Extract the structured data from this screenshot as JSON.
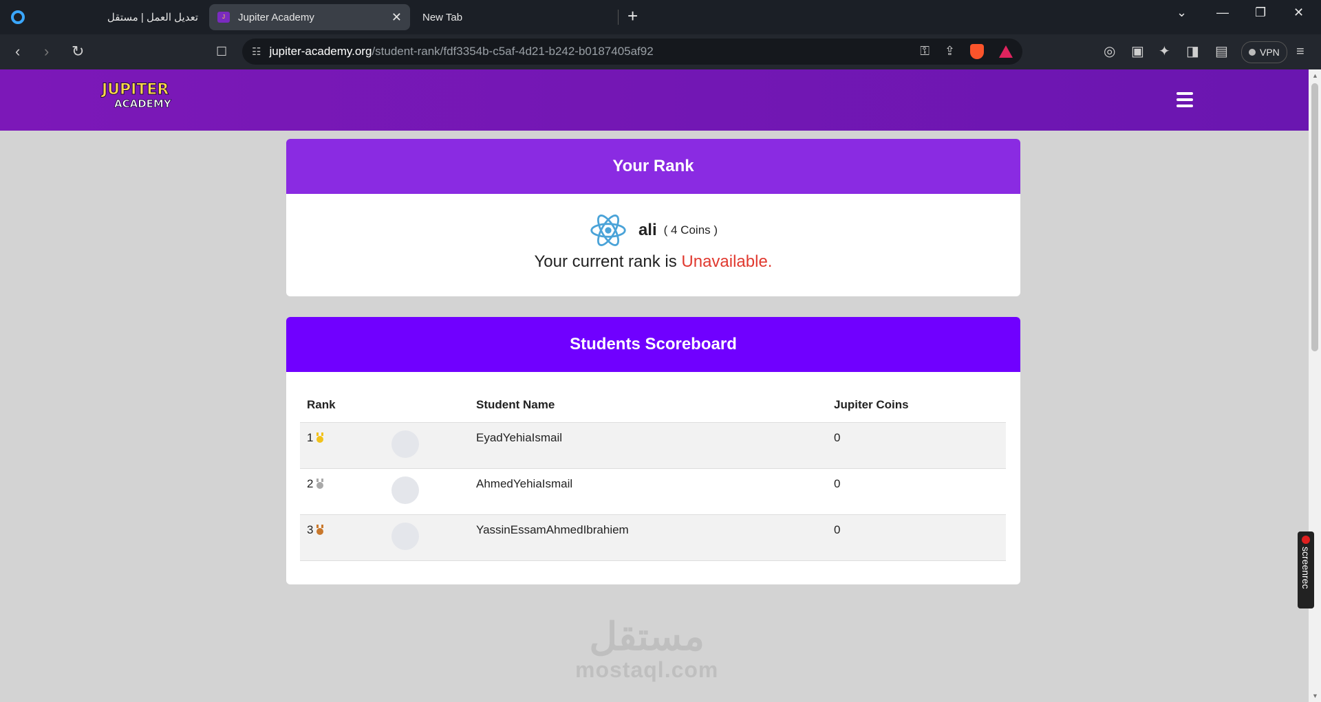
{
  "browser": {
    "tabs": [
      {
        "title": "تعديل العمل | مستقل"
      },
      {
        "title": "Jupiter Academy",
        "close": "✕"
      },
      {
        "title": "New Tab"
      }
    ],
    "new_tab": "+",
    "window_controls": {
      "dropdown": "⌄",
      "minimize": "—",
      "restore": "❐",
      "close": "✕"
    },
    "url_host": "jupiter-academy.org",
    "url_path": "/student-rank/fdf3354b-c5af-4d21-b242-b0187405af92",
    "vpn_label": "VPN"
  },
  "site": {
    "logo_top": "JUPITER",
    "logo_bottom": "ACADEMY",
    "accent": "#6a16b0"
  },
  "rank_card": {
    "title": "Your Rank",
    "user_name": "ali",
    "coins": "( 4 Coins )",
    "rank_prefix": "Your current rank is ",
    "rank_status": "Unavailable."
  },
  "scoreboard": {
    "title": "Students Scoreboard",
    "columns": [
      "Rank",
      "",
      "Student Name",
      "Jupiter Coins"
    ],
    "rows": [
      {
        "rank": "1",
        "medal": "gold-medal-icon",
        "medal_color": "#f2c21b",
        "name": "EyadYehiaIsmail",
        "coins": "0"
      },
      {
        "rank": "2",
        "medal": "silver-medal-icon",
        "medal_color": "#a9a9a9",
        "name": "AhmedYehiaIsmail",
        "coins": "0"
      },
      {
        "rank": "3",
        "medal": "bronze-medal-icon",
        "medal_color": "#c9782c",
        "name": "YassinEssamAhmedIbrahiem",
        "coins": "0"
      }
    ]
  },
  "watermark": {
    "arabic": "مستقل",
    "latin": "mostaql.com"
  },
  "screenrec": {
    "label": "screenrec"
  }
}
